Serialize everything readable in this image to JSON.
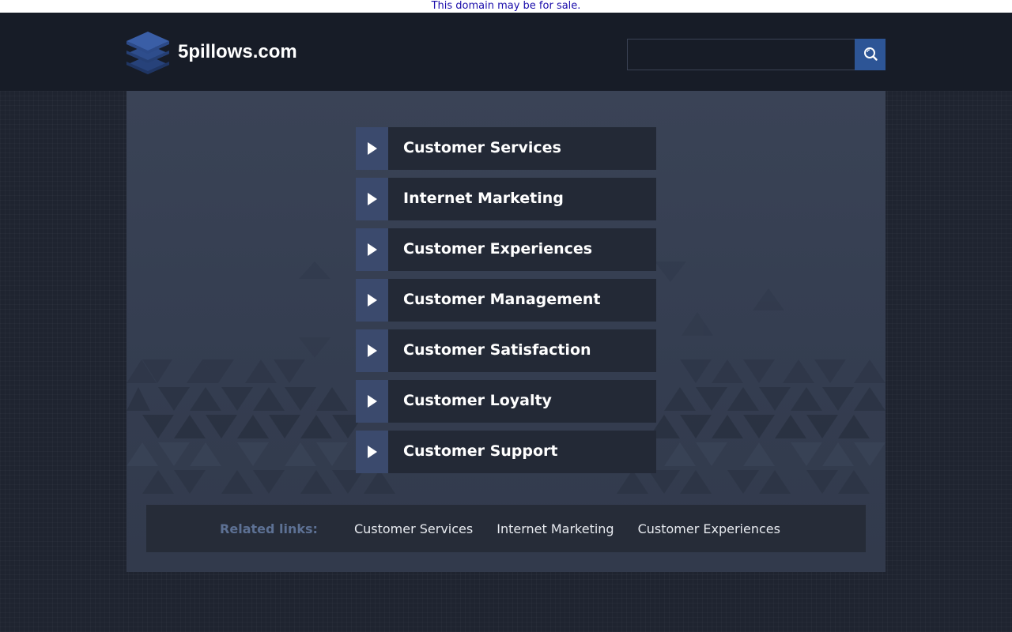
{
  "sale_notice": "This domain may be for sale.",
  "header": {
    "site_name": "5pillows.com",
    "search": {
      "value": "",
      "placeholder": ""
    }
  },
  "links": [
    {
      "label": "Customer Services"
    },
    {
      "label": "Internet Marketing"
    },
    {
      "label": "Customer Experiences"
    },
    {
      "label": "Customer Management"
    },
    {
      "label": "Customer Satisfaction"
    },
    {
      "label": "Customer Loyalty"
    },
    {
      "label": "Customer Support"
    }
  ],
  "related": {
    "title": "Related links:",
    "links": [
      {
        "label": "Customer Services"
      },
      {
        "label": "Internet Marketing"
      },
      {
        "label": "Customer Experiences"
      }
    ]
  },
  "icons": {
    "logo": "stacked-layers-logo-icon",
    "search": "search-icon",
    "link_arrow": "play-arrow-icon"
  },
  "colors": {
    "page_bg": "#1f2430",
    "header_bg": "#171c27",
    "accent": "#2d5596",
    "panel_bg": "#3a4356",
    "link_bg": "#232936",
    "arrow_bg": "#3b4a6d",
    "related_title": "#5d7194",
    "sale_link": "#1a0dab"
  }
}
